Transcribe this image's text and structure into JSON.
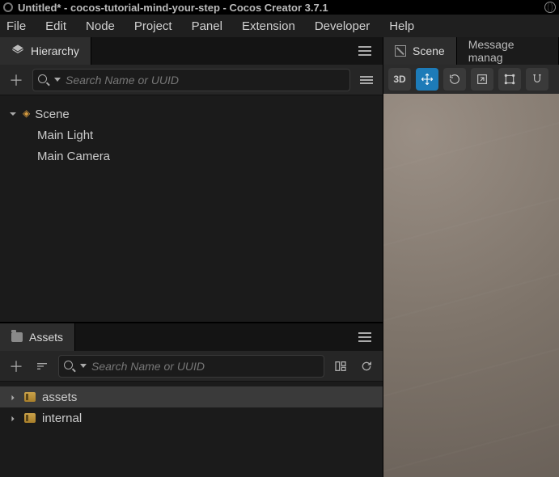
{
  "window": {
    "title": "Untitled* - cocos-tutorial-mind-your-step - Cocos Creator 3.7.1"
  },
  "menu": [
    "File",
    "Edit",
    "Node",
    "Project",
    "Panel",
    "Extension",
    "Developer",
    "Help"
  ],
  "hierarchy": {
    "tab_label": "Hierarchy",
    "search_placeholder": "Search Name or UUID",
    "root": {
      "label": "Scene"
    },
    "nodes": [
      {
        "label": "Main Light"
      },
      {
        "label": "Main Camera"
      }
    ]
  },
  "assets": {
    "tab_label": "Assets",
    "search_placeholder": "Search Name or UUID",
    "items": [
      {
        "label": "assets"
      },
      {
        "label": "internal"
      }
    ]
  },
  "scene": {
    "tabs": [
      {
        "label": "Scene"
      },
      {
        "label": "Message manag"
      }
    ],
    "view_mode": "3D"
  }
}
